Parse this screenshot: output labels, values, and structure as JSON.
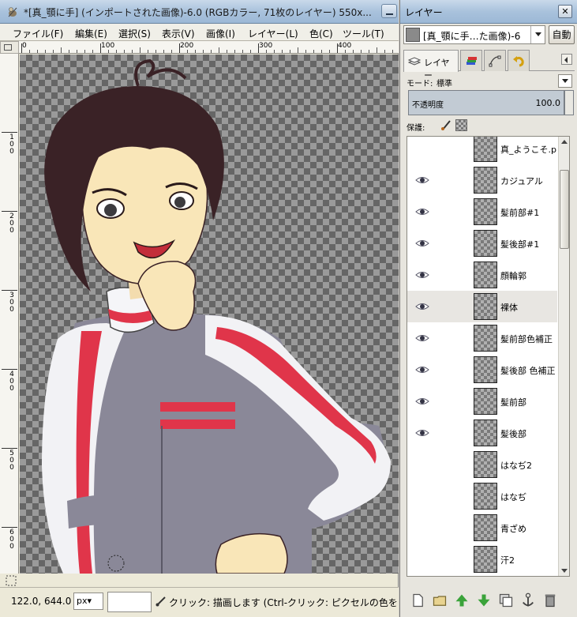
{
  "image_window": {
    "title": "*[真_顎に手] (インポートされた画像)-6.0 (RGBカラー, 71枚のレイヤー) 550x...",
    "menu": [
      {
        "label": "ファイル(F)"
      },
      {
        "label": "編集(E)"
      },
      {
        "label": "選択(S)"
      },
      {
        "label": "表示(V)"
      },
      {
        "label": "画像(I)"
      },
      {
        "label": "レイヤー(L)"
      },
      {
        "label": "色(C)"
      },
      {
        "label": "ツール(T)"
      }
    ],
    "ruler_h_labels": [
      "0",
      "100",
      "200",
      "300",
      "400"
    ],
    "ruler_v_labels": [
      "1\n0\n0",
      "2\n0\n0",
      "3\n0\n0",
      "4\n0\n0",
      "5\n0\n0",
      "6\n0\n0"
    ],
    "status": {
      "coords": "122.0, 644.0",
      "unit": "px▾",
      "message": "クリック: 描画します (Ctrl-クリック: ピクセルの色を選"
    }
  },
  "layers_dock": {
    "title": "レイヤー",
    "image_selector": "[真_顎に手…た画像)-6",
    "auto_button": "自動",
    "tab_layers_label": "レイヤー",
    "mode_label": "モード:",
    "mode_value": "標準",
    "opacity_label": "不透明度",
    "opacity_value": "100.0",
    "lock_label": "保護:",
    "layers": [
      {
        "name": "真_ようこそ.png",
        "visible": false,
        "selected": false
      },
      {
        "name": "カジュアル",
        "visible": true,
        "selected": false
      },
      {
        "name": "髪前部#1",
        "visible": true,
        "selected": false
      },
      {
        "name": "髪後部#1",
        "visible": true,
        "selected": false
      },
      {
        "name": "顔輪郭",
        "visible": true,
        "selected": false
      },
      {
        "name": "裸体",
        "visible": true,
        "selected": true
      },
      {
        "name": "髪前部色補正",
        "visible": true,
        "selected": false
      },
      {
        "name": "髪後部 色補正",
        "visible": true,
        "selected": false
      },
      {
        "name": "髪前部",
        "visible": true,
        "selected": false
      },
      {
        "name": "髪後部",
        "visible": true,
        "selected": false
      },
      {
        "name": "はなぢ2",
        "visible": false,
        "selected": false
      },
      {
        "name": "はなぢ",
        "visible": false,
        "selected": false
      },
      {
        "name": "青ざめ",
        "visible": false,
        "selected": false
      },
      {
        "name": "汗2",
        "visible": false,
        "selected": false
      }
    ]
  },
  "colors": {
    "jacket_white": "#f2f2f5",
    "jacket_red": "#e0354a",
    "jacket_gray": "#8a8898",
    "hair": "#3a2226",
    "skin": "#f9e6b8"
  }
}
